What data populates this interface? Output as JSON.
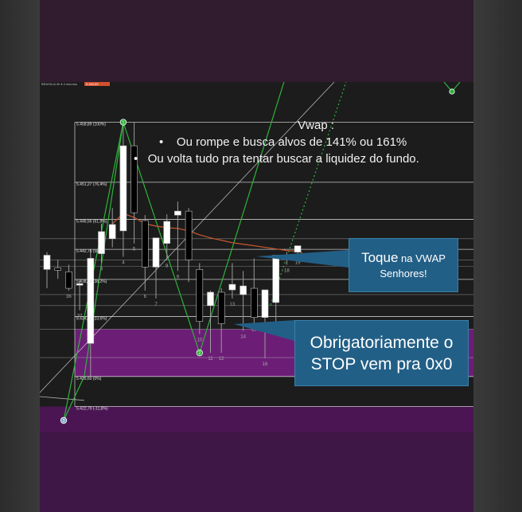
{
  "colors": {
    "background": "#1c1c1c",
    "candle_up": "#ffffff",
    "candle_down": "#000000",
    "zigzag": "#2db33a",
    "fib_lines": "#ffffff",
    "vwap": "#c0552d",
    "zone": "#7a1e86",
    "callout": "#225f86"
  },
  "header": {
    "menu_text": "BRASILIA 4h ▾  4 minutos",
    "price_badge": "5.450,89"
  },
  "annotations": {
    "vwap_title": "Vwap :",
    "vwap_bullets": [
      "Ou rompe e busca alvos de 141% ou 161%",
      "Ou volta tudo pra tentar buscar a liquidez do fundo."
    ],
    "toque_big": "Toque",
    "toque_small": " na VWAP",
    "toque_line2": "Senhores!",
    "stop_line1": "Obrigatoriamente o",
    "stop_line2": "STOP vem pra 0x0"
  },
  "chart_data": {
    "type": "candlestick",
    "fib_levels": [
      {
        "label": "5.458,89 (100%)",
        "value": 5458.89
      },
      {
        "label": "5.451,27 (76,4%)",
        "value": 5451.27
      },
      {
        "label": "5.446,56 (61,8%)",
        "value": 5446.56
      },
      {
        "label": "5.442,75 (50%)",
        "value": 5442.75
      },
      {
        "label": "5.438,93 (38,2%)",
        "value": 5438.93
      },
      {
        "label": "5.434,22 (23,6%)",
        "value": 5434.22
      },
      {
        "label": "5.426,60 (0%)",
        "value": 5426.6
      },
      {
        "label": "5.422,79 (-11,8%)",
        "value": 5422.79
      }
    ],
    "extra_levels": [
      5444.1,
      5441.4,
      5440.6,
      5437.0,
      5435.6,
      5432.6,
      5429.0
    ],
    "candles": [
      {
        "label": "",
        "o": 5440.2,
        "h": 5442.4,
        "l": 5437.8,
        "c": 5442.0
      },
      {
        "label": "",
        "o": 5440.4,
        "h": 5441.4,
        "l": 5439.0,
        "c": 5440.1
      },
      {
        "label": "36",
        "o": 5439.9,
        "h": 5440.8,
        "l": 5437.5,
        "c": 5437.8
      },
      {
        "label": "37",
        "o": 5438.2,
        "h": 5439.0,
        "l": 5435.0,
        "c": 5438.4
      },
      {
        "label": "",
        "o": 5430.8,
        "h": 5442.8,
        "l": 5426.6,
        "c": 5441.6
      },
      {
        "label": "3",
        "o": 5442.2,
        "h": 5446.0,
        "l": 5441.0,
        "c": 5445.0
      },
      {
        "label": "",
        "o": 5444.1,
        "h": 5448.0,
        "l": 5443.0,
        "c": 5445.9
      },
      {
        "label": "4",
        "o": 5445.1,
        "h": 5458.89,
        "l": 5441.8,
        "c": 5455.9
      },
      {
        "label": "5",
        "o": 5455.9,
        "h": 5458.89,
        "l": 5443.5,
        "c": 5447.4
      },
      {
        "label": "6",
        "o": 5446.4,
        "h": 5447.1,
        "l": 5437.5,
        "c": 5440.5
      },
      {
        "label": "7",
        "o": 5440.5,
        "h": 5444.0,
        "l": 5436.5,
        "c": 5444.2
      },
      {
        "label": "8",
        "o": 5443.5,
        "h": 5447.2,
        "l": 5441.4,
        "c": 5446.3
      },
      {
        "label": "9",
        "o": 5447.1,
        "h": 5448.8,
        "l": 5440.0,
        "c": 5447.6
      },
      {
        "label": "",
        "o": 5447.6,
        "h": 5448.0,
        "l": 5438.6,
        "c": 5441.4
      },
      {
        "label": "10",
        "o": 5440.2,
        "h": 5441.0,
        "l": 5432.0,
        "c": 5433.6
      },
      {
        "label": "11",
        "o": 5435.6,
        "h": 5437.5,
        "l": 5429.6,
        "c": 5437.3
      },
      {
        "label": "12",
        "o": 5437.3,
        "h": 5437.8,
        "l": 5429.6,
        "c": 5433.3
      },
      {
        "label": "13",
        "o": 5437.6,
        "h": 5441.0,
        "l": 5436.5,
        "c": 5438.3
      },
      {
        "label": "14",
        "o": 5437.0,
        "h": 5440.0,
        "l": 5432.4,
        "c": 5438.1
      },
      {
        "label": "15",
        "o": 5437.8,
        "h": 5441.6,
        "l": 5433.3,
        "c": 5434.1
      },
      {
        "label": "16",
        "o": 5434.1,
        "h": 5436.9,
        "l": 5428.9,
        "c": 5437.6
      },
      {
        "label": "17",
        "o": 5436.0,
        "h": 5442.0,
        "l": 5433.0,
        "c": 5442.0
      },
      {
        "label": "18",
        "o": 5441.6,
        "h": 5442.4,
        "l": 5440.8,
        "c": 5441.9
      },
      {
        "label": "19",
        "o": 5442.4,
        "h": 5443.2,
        "l": 5441.8,
        "c": 5443.2
      }
    ],
    "vwap": [
      null,
      null,
      null,
      null,
      null,
      null,
      5446.0,
      5447.3,
      5446.8,
      5446.0,
      5445.7,
      5445.5,
      5445.4,
      5445.1,
      5444.6,
      5444.2,
      5443.9,
      5443.6,
      5443.4,
      5443.2,
      5443.0,
      5442.8,
      5442.6,
      5442.5
    ],
    "zigzag_labels": [
      "1",
      "2",
      "3"
    ],
    "price_range": [
      5419.5,
      5464.0
    ]
  }
}
